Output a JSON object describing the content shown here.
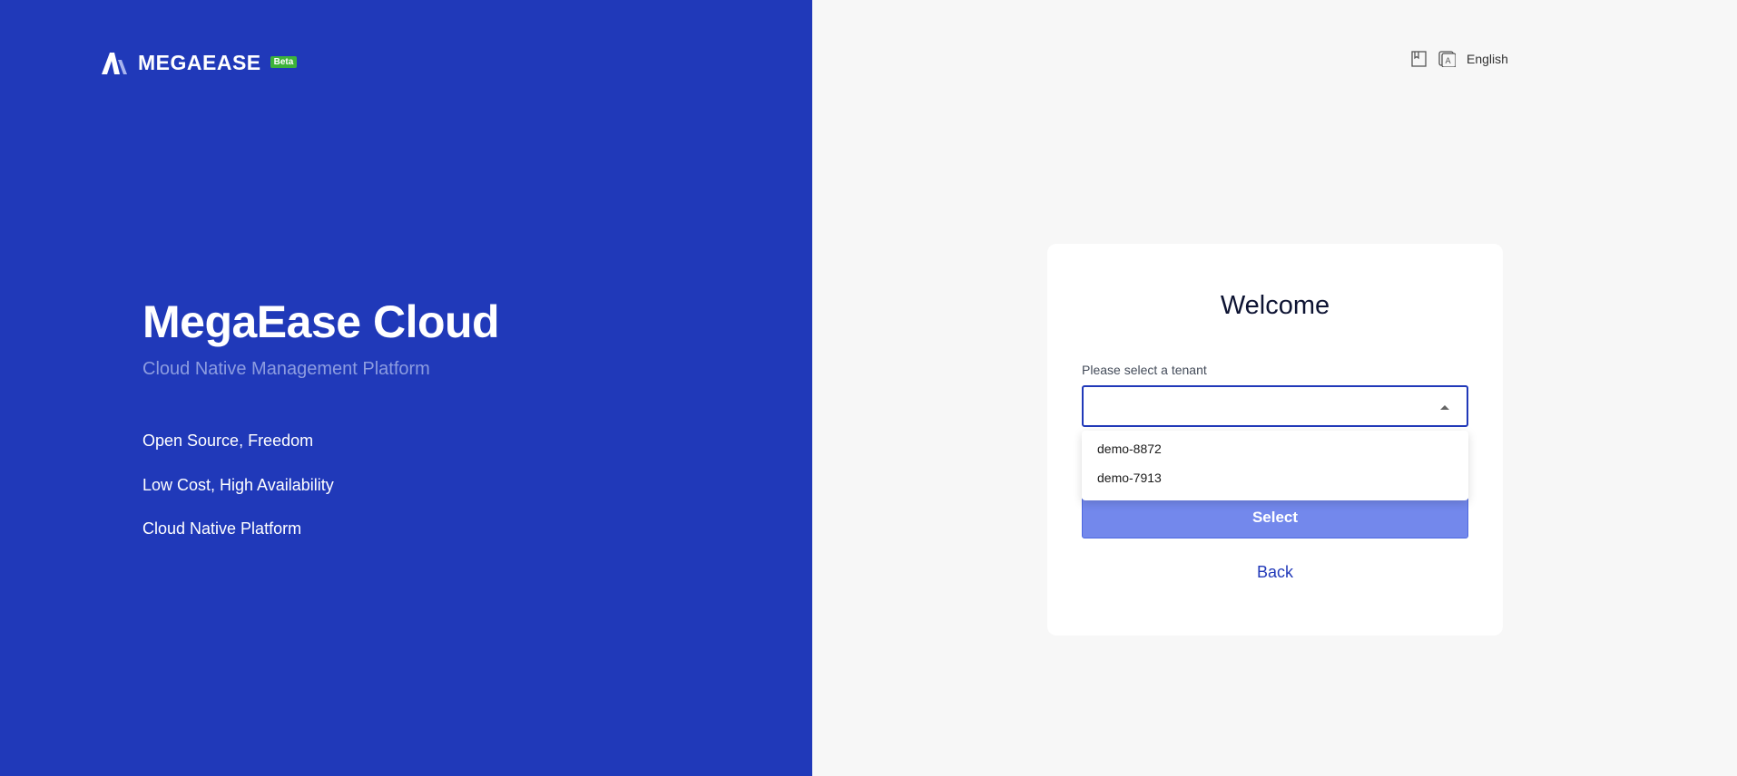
{
  "brand": {
    "logo_icon": "megaease-logo-icon",
    "name": "MEGAEASE",
    "badge": "Beta"
  },
  "hero": {
    "title": "MegaEase Cloud",
    "subtitle": "Cloud Native Management Platform",
    "features": [
      "Open Source, Freedom",
      "Low Cost, High Availability",
      "Cloud Native Platform"
    ]
  },
  "topbar": {
    "docs_icon": "book-icon",
    "translate_icon": "translate-icon",
    "language": "English"
  },
  "card": {
    "title": "Welcome",
    "tenant_label": "Please select a tenant",
    "tenant_value": "",
    "tenant_options": [
      "demo-8872",
      "demo-7913"
    ],
    "select_button": "Select",
    "back_link": "Back"
  },
  "colors": {
    "brand_blue": "#2039b9",
    "button_blue": "#7388ec",
    "beta_green": "#3db33a",
    "page_bg": "#f7f7f7"
  }
}
